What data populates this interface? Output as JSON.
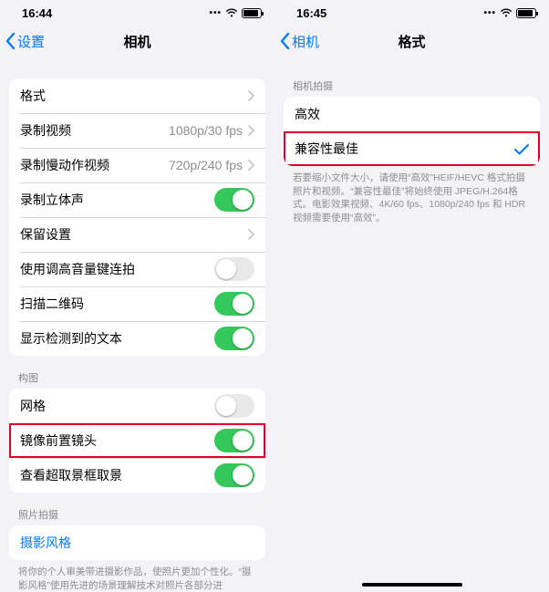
{
  "left": {
    "status": {
      "time": "16:44"
    },
    "nav": {
      "back": "设置",
      "title": "相机"
    },
    "group1": {
      "formats": {
        "label": "格式"
      },
      "record_video": {
        "label": "录制视频",
        "detail": "1080p/30 fps"
      },
      "record_slomo": {
        "label": "录制慢动作视频",
        "detail": "720p/240 fps"
      },
      "stereo": {
        "label": "录制立体声"
      },
      "preserve": {
        "label": "保留设置"
      },
      "vol_burst": {
        "label": "使用调高音量键连拍"
      },
      "scan_qr": {
        "label": "扫描二维码"
      },
      "detect_text": {
        "label": "显示检测到的文本"
      }
    },
    "section_compose": "构图",
    "group2": {
      "grid": {
        "label": "网格"
      },
      "mirror_front": {
        "label": "镜像前置镜头"
      },
      "view_outside": {
        "label": "查看超取景框取景"
      }
    },
    "section_capture": "照片拍摄",
    "group3": {
      "styles": {
        "label": "摄影风格"
      }
    },
    "footer": "将你的个人审美带进摄影作品，使照片更加个性化。“摄影风格”使用先进的场景理解技术对照片各部分进"
  },
  "right": {
    "status": {
      "time": "16:45"
    },
    "nav": {
      "back": "相机",
      "title": "格式"
    },
    "section": "相机拍摄",
    "group": {
      "high_eff": {
        "label": "高效"
      },
      "most_compat": {
        "label": "兼容性最佳"
      }
    },
    "footer": "若要缩小文件大小，请使用“高效”HEIF/HEVC 格式拍摄照片和视频。“兼容性最佳”将始终使用 JPEG/H.264格式。电影效果视频、4K/60 fps、1080p/240 fps 和 HDR 视频需要使用“高效”。"
  }
}
